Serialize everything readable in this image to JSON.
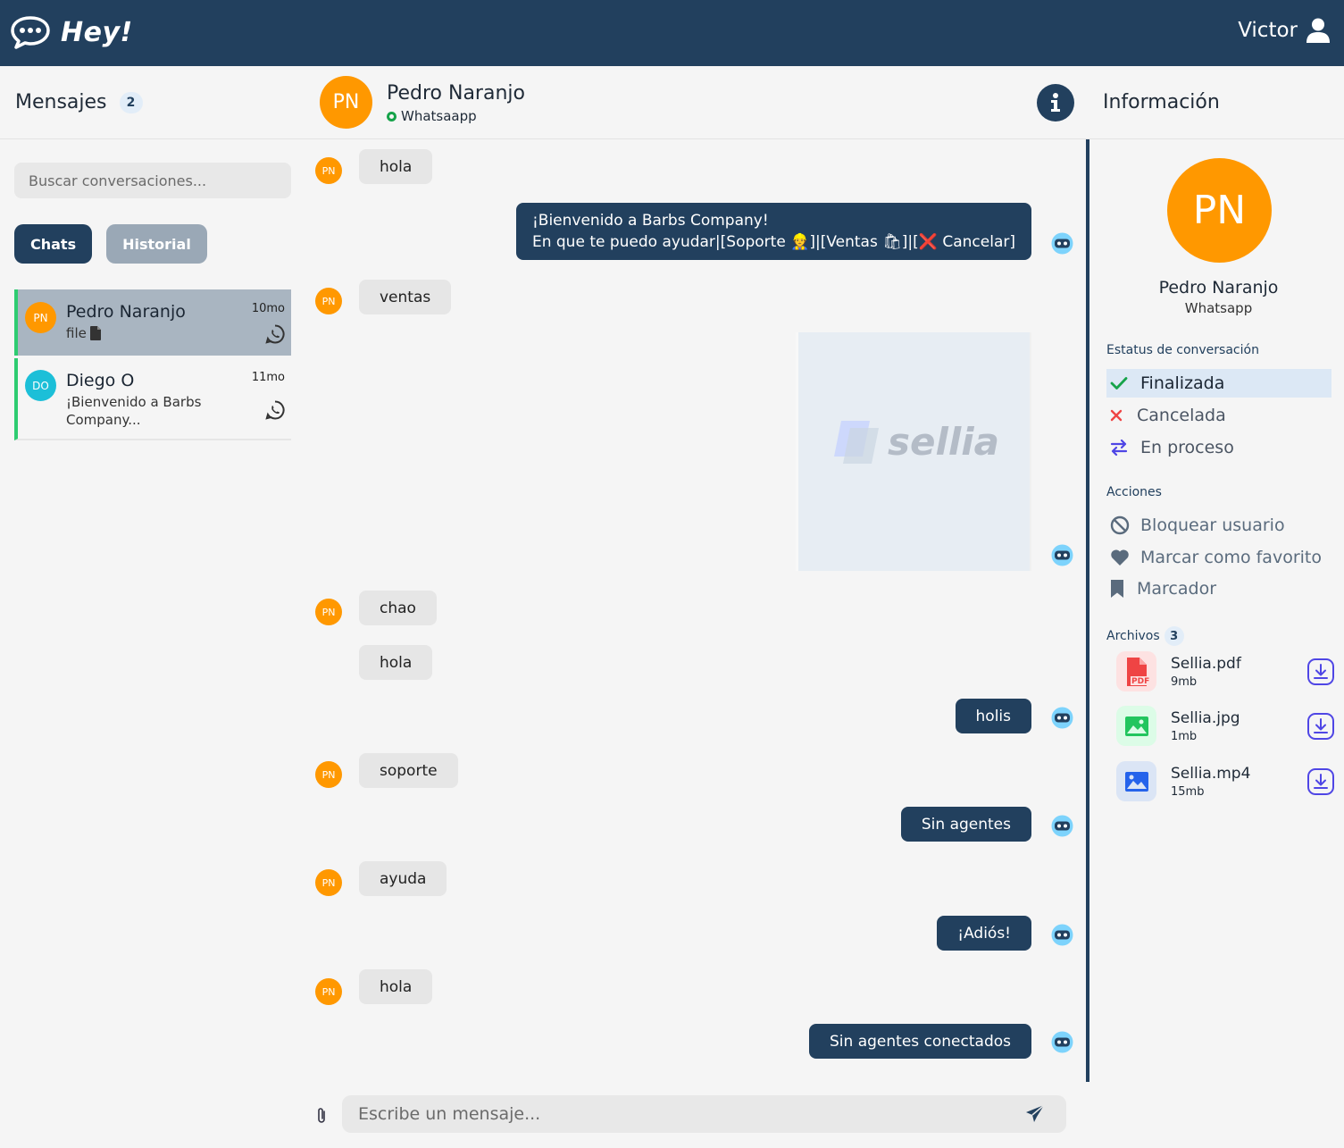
{
  "app": {
    "name": "Hey!",
    "user_name": "Victor"
  },
  "sidebar": {
    "title": "Mensajes",
    "count": "2",
    "search_placeholder": "Buscar conversaciones...",
    "tabs": [
      {
        "label": "Chats",
        "active": true
      },
      {
        "label": "Historial",
        "active": false
      }
    ],
    "conversations": [
      {
        "initials": "PN",
        "name": "Pedro Naranjo",
        "time": "10mo",
        "preview": "file",
        "avatar_color": "#ff9800",
        "channel_icon": "whatsapp-icon"
      },
      {
        "initials": "DO",
        "name": "Diego O",
        "time": "11mo",
        "preview_line1": "¡Bienvenido a Barbs",
        "preview_line2": "Company...",
        "avatar_color": "#1cbfd8",
        "channel_icon": "whatsapp-icon"
      }
    ]
  },
  "chat": {
    "initials": "PN",
    "name": "Pedro Naranjo",
    "channel": "Whatsaapp",
    "messages": [
      {
        "dir": "in",
        "text": "hola"
      },
      {
        "dir": "out",
        "line1": "¡Bienvenido a Barbs Company!",
        "line2": "En que te puedo ayudar|[Soporte 👷]|[Ventas 🛍]|[❌ Cancelar]"
      },
      {
        "dir": "in",
        "text": "ventas"
      },
      {
        "dir": "out",
        "type": "image",
        "image_text": "sellia"
      },
      {
        "dir": "in",
        "text": "chao"
      },
      {
        "dir": "in",
        "text": "hola"
      },
      {
        "dir": "out",
        "text": "holis"
      },
      {
        "dir": "in",
        "text": "soporte"
      },
      {
        "dir": "out",
        "text": "Sin agentes"
      },
      {
        "dir": "in",
        "text": "ayuda"
      },
      {
        "dir": "out",
        "text": "¡Adiós!"
      },
      {
        "dir": "in",
        "text": "hola"
      },
      {
        "dir": "out",
        "text": "Sin agentes conectados"
      }
    ],
    "composer_placeholder": "Escribe un mensaje..."
  },
  "info": {
    "title": "Información",
    "initials": "PN",
    "name": "Pedro Naranjo",
    "channel": "Whatsapp",
    "status_title": "Estatus de conversación",
    "statuses": [
      {
        "label": "Finalizada",
        "selected": true,
        "icon": "check-icon",
        "color": "#16a34a"
      },
      {
        "label": "Cancelada",
        "selected": false,
        "icon": "x-icon",
        "color": "#ef4444"
      },
      {
        "label": "En proceso",
        "selected": false,
        "icon": "arrows-icon",
        "color": "#4f46e5"
      }
    ],
    "actions_title": "Acciones",
    "actions": [
      {
        "label": "Bloquear usuario",
        "icon": "ban-icon"
      },
      {
        "label": "Marcar como favorito",
        "icon": "heart-icon"
      },
      {
        "label": "Marcador",
        "icon": "bookmark-icon"
      }
    ],
    "files_title": "Archivos",
    "files_count": "3",
    "files": [
      {
        "name": "Sellia.pdf",
        "size": "9mb",
        "icon": "pdf-icon",
        "color": "#ef4444"
      },
      {
        "name": "Sellia.jpg",
        "size": "1mb",
        "icon": "image-icon",
        "color": "#22c55e"
      },
      {
        "name": "Sellia.mp4",
        "size": "15mb",
        "icon": "image-icon",
        "color": "#2563eb"
      }
    ]
  }
}
